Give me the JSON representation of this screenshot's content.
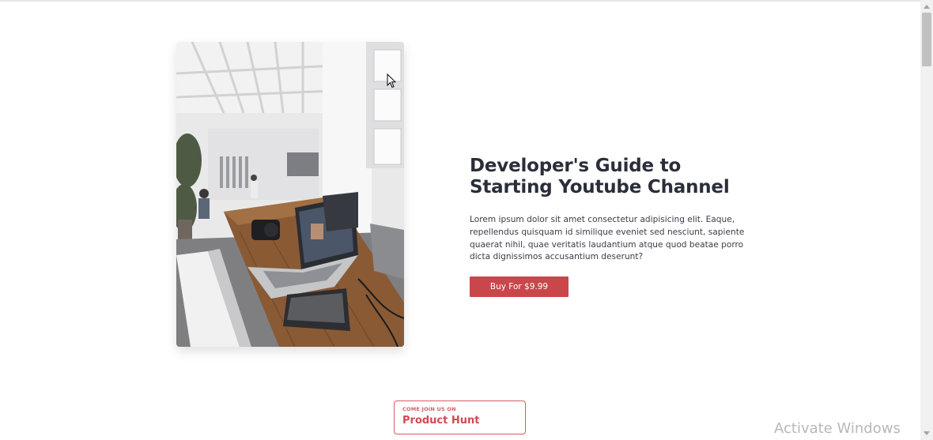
{
  "hero": {
    "image_alt": "workspace-photo",
    "title": "Developer's Guide to Starting Youtube Channel",
    "body": "Lorem ipsum dolor sit amet consectetur adipisicing elit. Eaque, repellendus quisquam id similique eveniet sed nesciunt, sapiente quaerat nihil, quae veritatis laudantium atque quod beatae porro dicta dignissimos accusantium deserunt?",
    "buy_label": "Buy For $9.99"
  },
  "product_hunt": {
    "kicker": "COME JOIN US ON",
    "name": "Product Hunt"
  },
  "watermark": "Activate Windows",
  "colors": {
    "accent": "#c9474b",
    "product_hunt": "#da5b65",
    "title": "#2b2e3a"
  },
  "icons": {
    "cursor": "mouse-pointer-icon",
    "scroll_up": "scroll-up-arrow-icon",
    "scroll_down": "scroll-down-arrow-icon"
  }
}
